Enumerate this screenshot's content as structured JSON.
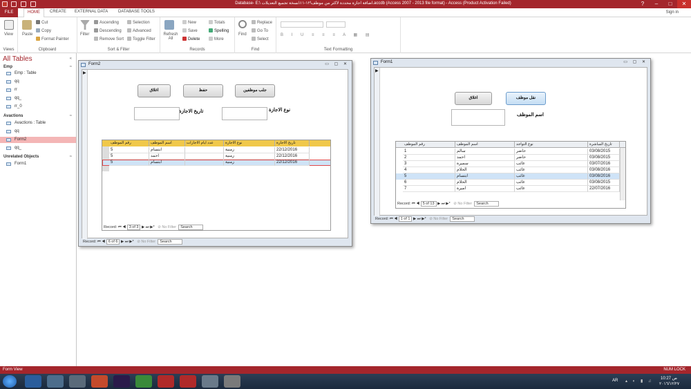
{
  "title": "Database- E:\\ اضافة اجازة محددة لاكثر من موظف\\١٢-١١\\نسخة تجميع التعديلات.accdb (Access 2007 - 2013 file format) - Access (Product Activation Failed)",
  "titlebar": {
    "help": "?",
    "min": "–",
    "max": "□",
    "close": "✕"
  },
  "tabs": {
    "file": "FILE",
    "home": "HOME",
    "create": "CREATE",
    "external": "EXTERNAL DATA",
    "dbtools": "DATABASE TOOLS",
    "signin": "Sign in"
  },
  "ribbon": {
    "views": {
      "view": "View",
      "label": "Views"
    },
    "clipboard": {
      "paste": "Paste",
      "cut": "Cut",
      "copy": "Copy",
      "painter": "Format Painter",
      "label": "Clipboard"
    },
    "sort": {
      "filter": "Filter",
      "asc": "Ascending",
      "desc": "Descending",
      "remove": "Remove Sort",
      "selection": "Selection",
      "advanced": "Advanced",
      "toggle": "Toggle Filter",
      "label": "Sort & Filter"
    },
    "records": {
      "refresh": "Refresh All",
      "new": "New",
      "save": "Save",
      "delete": "Delete",
      "totals": "Totals",
      "spelling": "Spelling",
      "more": "More",
      "label": "Records"
    },
    "find": {
      "find": "Find",
      "replace": "Replace",
      "goto": "Go To",
      "select": "Select",
      "label": "Find"
    },
    "text": {
      "label": "Text Formatting"
    }
  },
  "nav": {
    "title": "All Tables",
    "groups": [
      {
        "name": "Emp",
        "items": [
          "Emp : Table",
          "qq",
          "rr",
          "qq_",
          "rr_0"
        ]
      },
      {
        "name": "Avactions",
        "items": [
          "Avactions : Table",
          "qq",
          "Form2",
          "qq_"
        ]
      },
      {
        "name": "Unrelated Objects",
        "items": [
          "Form1"
        ]
      }
    ]
  },
  "form2": {
    "title": "Form2",
    "btn_fetch": "جلب موظفين",
    "btn_save": "حفظ",
    "btn_close": "اغلاق",
    "lbl_type": "نوع الاجازة",
    "lbl_date": "تاريخ الاجازة",
    "columns": [
      "تاريخ الاجازة",
      "نوع الاجازة",
      "عدد ايام الاجازات",
      "اسم الموظف",
      "رقم الموظف"
    ],
    "rows": [
      [
        "22/12/2016",
        "زمنية",
        "",
        "ابتسام",
        "5"
      ],
      [
        "22/12/2016",
        "زمنية",
        "",
        "احمد",
        "5"
      ],
      [
        "22/12/2016",
        "زمنية",
        "",
        "ابتسام",
        "5"
      ]
    ],
    "sub_nav": {
      "record": "Record:",
      "pos": "3 of 3",
      "nofilter": "No Filter",
      "search": "Search"
    },
    "nav": {
      "record": "Record:",
      "pos": "6 of 6",
      "nofilter": "No Filter",
      "search": "Search"
    }
  },
  "form1": {
    "title": "Form1",
    "btn_move": "نقل موظف",
    "btn_close": "اغلاق",
    "lbl_name": "اسم الموظف",
    "columns": [
      "تاريخ المباشرة",
      "نوع التواجد",
      "اسم الموظف",
      "رقم الموظف"
    ],
    "rows": [
      [
        "03/08/2015",
        "حاضر",
        "سالم",
        "1"
      ],
      [
        "03/08/2015",
        "حاضر",
        "احمد",
        "2"
      ],
      [
        "03/07/2016",
        "غائب",
        "سميرة",
        "3"
      ],
      [
        "03/08/2016",
        "غائب",
        "الحلام",
        "4"
      ],
      [
        "03/08/2016",
        "غائب",
        "ابتسام",
        "5"
      ],
      [
        "03/08/2015",
        "غائب",
        "الحلام",
        "6"
      ],
      [
        "22/07/2016",
        "غائب",
        "اميرة",
        "7"
      ]
    ],
    "sub_nav": {
      "record": "Record:",
      "pos": "5 of 13",
      "nofilter": "No Filter",
      "search": "Search"
    },
    "nav": {
      "record": "Record:",
      "pos": "1 of 1",
      "nofilter": "No Filter",
      "search": "Search"
    }
  },
  "status": {
    "left": "Form View",
    "right": "NUM LOCK"
  },
  "taskbar": {
    "lang": "AR",
    "time": "10:27 ص",
    "date": "٢٠١٦/١٢/٢٧"
  }
}
